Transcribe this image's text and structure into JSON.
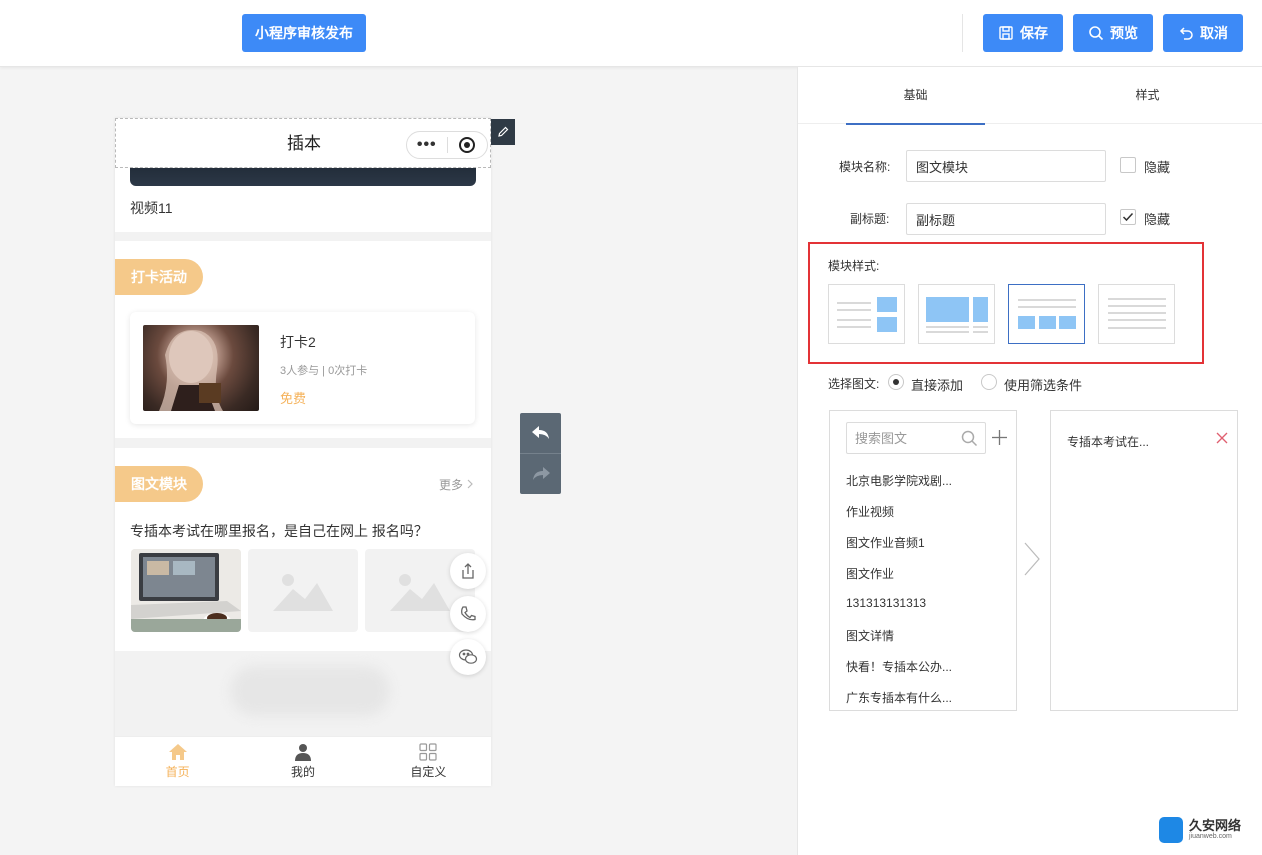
{
  "toolbar": {
    "publish_label": "小程序审核发布",
    "save_label": "保存",
    "preview_label": "预览",
    "cancel_label": "取消"
  },
  "phone": {
    "title": "插本",
    "capsule_dots": "•••",
    "video_name": "视频11",
    "checkin": {
      "section_title": "打卡活动",
      "title": "打卡2",
      "stats": "3人参与 | 0次打卡",
      "price": "免费"
    },
    "article": {
      "section_title": "图文模块",
      "more_label": "更多",
      "title": "专插本考试在哪里报名，是自己在网上 报名吗？"
    },
    "tabbar": [
      {
        "label": "首页",
        "icon": "home-icon",
        "active": true
      },
      {
        "label": "我的",
        "icon": "user-icon",
        "active": false
      },
      {
        "label": "自定义",
        "icon": "grid-icon",
        "active": false
      }
    ]
  },
  "panel": {
    "tabs": [
      {
        "label": "基础",
        "active": true
      },
      {
        "label": "样式",
        "active": false
      }
    ],
    "module_name": {
      "label": "模块名称:",
      "value": "图文模块",
      "hide_label": "隐藏",
      "hide_checked": false
    },
    "subtitle": {
      "label": "副标题:",
      "value": "副标题",
      "hide_label": "隐藏",
      "hide_checked": true
    },
    "module_style": {
      "label": "模块样式:",
      "selected_index": 2
    },
    "select_article": {
      "label": "选择图文:",
      "options": [
        {
          "label": "直接添加",
          "checked": true
        },
        {
          "label": "使用筛选条件",
          "checked": false
        }
      ]
    },
    "search": {
      "placeholder": "搜索图文"
    },
    "article_list": [
      "北京电影学院戏剧...",
      "作业视频",
      "图文作业音频1",
      "图文作业",
      "131313131313",
      "图文详情",
      "快看！专插本公办...",
      "广东专插本有什么..."
    ],
    "selected_list": [
      "专插本考试在..."
    ]
  },
  "watermark": {
    "name": "久安网络",
    "domain": "jiuanweb.com"
  },
  "colors": {
    "primary": "#3d8af7",
    "accent_orange": "#f5c98a",
    "highlight_red": "#e33236",
    "tab_underline": "#3d6fc4"
  }
}
